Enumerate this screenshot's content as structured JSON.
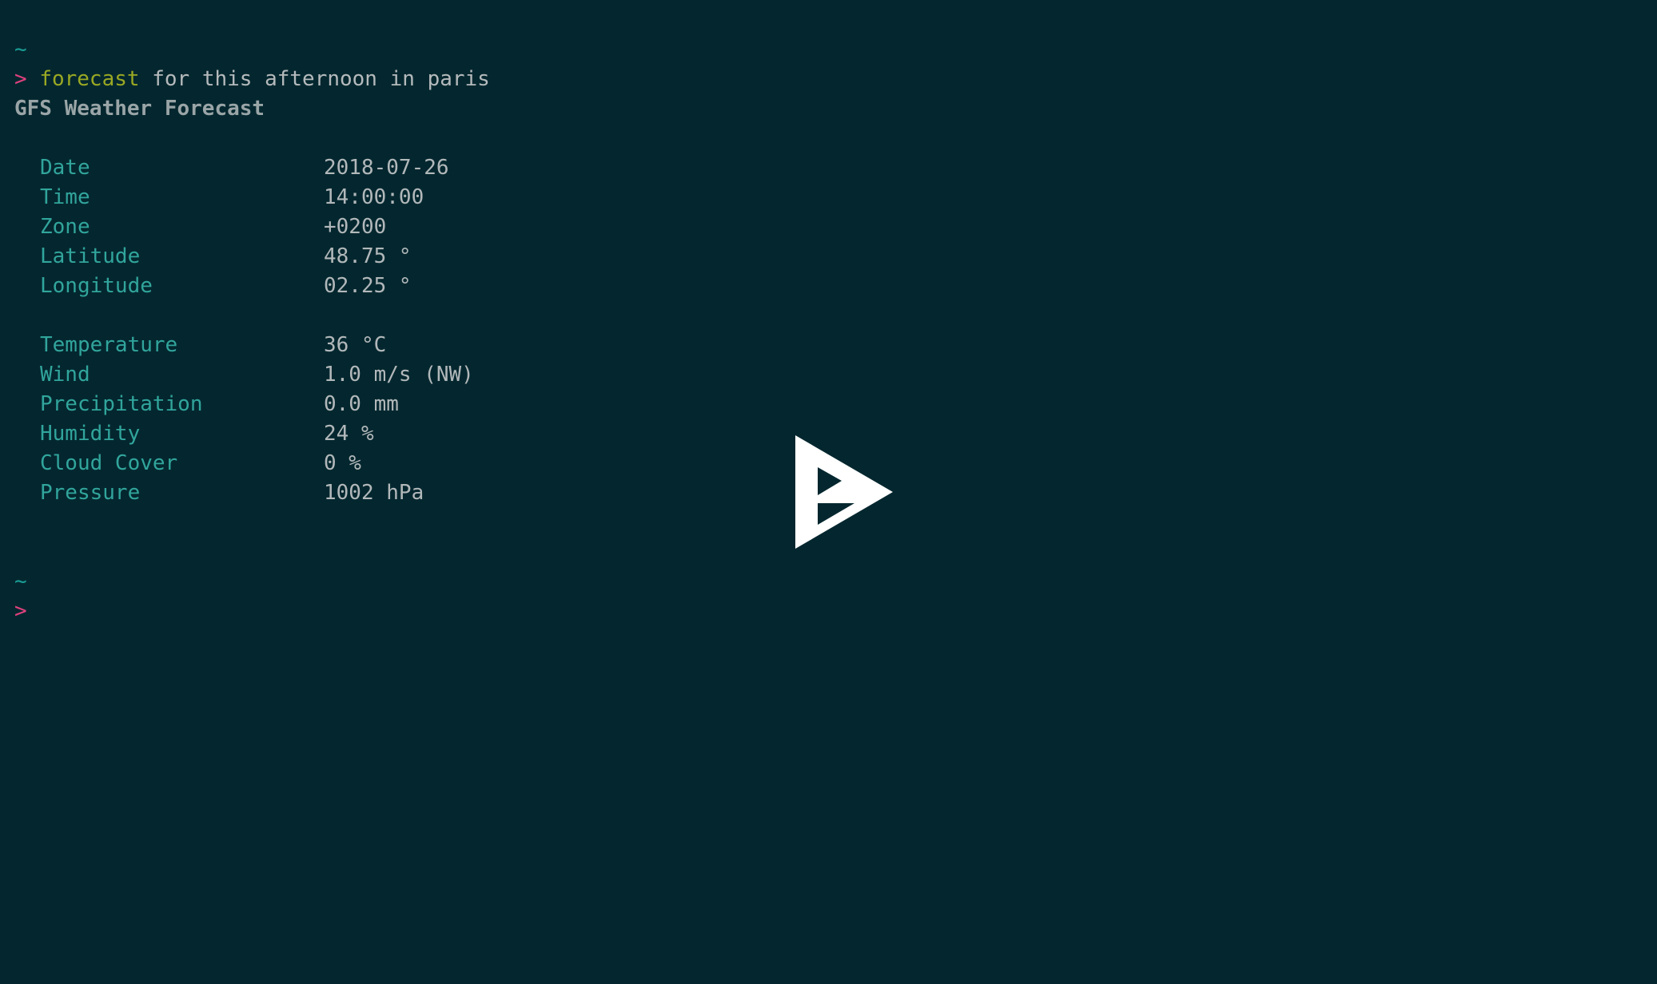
{
  "terminal": {
    "background_color": "#04272f",
    "tilde_symbol": "~",
    "prompt_symbol": ">",
    "prompt_color": "#e0417e",
    "tilde_color": "#1a9e96",
    "label_color": "#31a59c",
    "value_color": "#b2b8ba",
    "command_color": "#9aa823"
  },
  "command_line": {
    "command": "forecast",
    "arguments": " for this afternoon in paris"
  },
  "output": {
    "heading": "GFS Weather Forecast",
    "location_rows": [
      {
        "label": "Date",
        "value": "2018-07-26"
      },
      {
        "label": "Time",
        "value": "14:00:00"
      },
      {
        "label": "Zone",
        "value": "+0200"
      },
      {
        "label": "Latitude",
        "value": "48.75 °"
      },
      {
        "label": "Longitude",
        "value": "02.25 °"
      }
    ],
    "measurement_rows": [
      {
        "label": "Temperature",
        "value": "36 °C"
      },
      {
        "label": "Wind",
        "value": "1.0 m/s (NW)"
      },
      {
        "label": "Precipitation",
        "value": "0.0 mm"
      },
      {
        "label": "Humidity",
        "value": "24 %"
      },
      {
        "label": "Cloud Cover",
        "value": "0 %"
      },
      {
        "label": "Pressure",
        "value": "1002 hPa"
      }
    ]
  },
  "logo": {
    "name": "play-triangle-logo",
    "color": "#ffffff"
  }
}
